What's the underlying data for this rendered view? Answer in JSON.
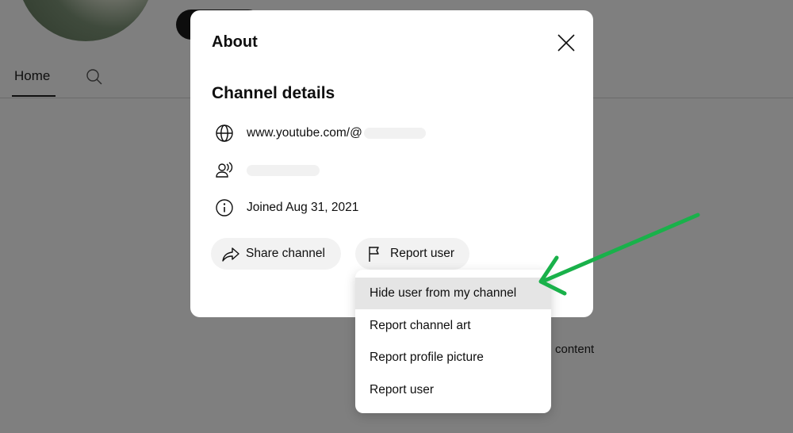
{
  "background": {
    "tabs": [
      {
        "label": "Home"
      }
    ],
    "partial_text": "content"
  },
  "dialog": {
    "title": "About",
    "section_title": "Channel details",
    "url": "www.youtube.com/@",
    "joined": "Joined Aug 31, 2021",
    "share_label": "Share channel",
    "report_label": "Report user"
  },
  "menu": {
    "items": [
      {
        "label": "Hide user from my channel",
        "highlighted": true
      },
      {
        "label": "Report channel art"
      },
      {
        "label": "Report profile picture"
      },
      {
        "label": "Report user"
      }
    ]
  },
  "colors": {
    "overlay": "#7f7f7f",
    "annotation_arrow": "#19b14a",
    "pill_bg": "#f2f2f2",
    "menu_highlight": "#e5e5e5"
  },
  "icons": {
    "url": "globe-icon",
    "subscribers": "subscribers-icon",
    "joined": "info-icon",
    "share": "share-icon",
    "report": "flag-icon",
    "close": "close-icon",
    "search": "search-icon"
  }
}
